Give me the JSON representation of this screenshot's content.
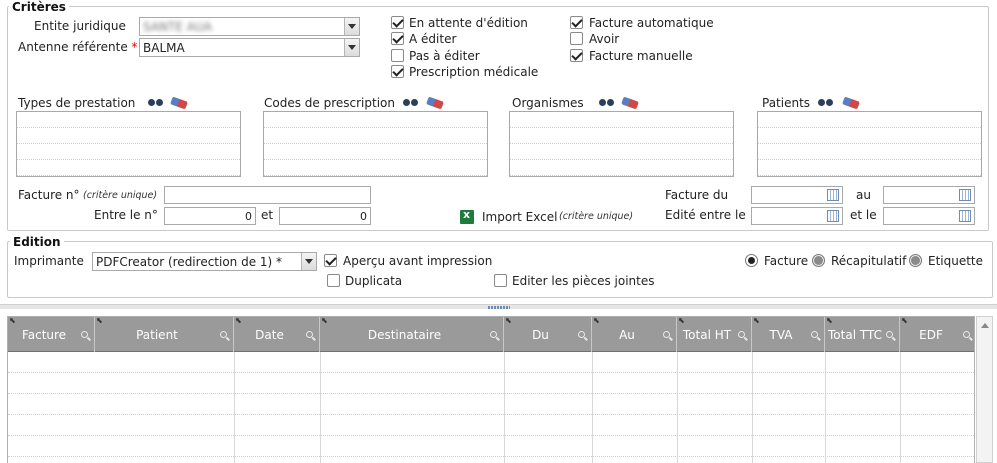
{
  "criteres": {
    "legend": "Critères",
    "entite_label": "Entite juridique",
    "entite_value": "SANTE AUA",
    "antenne_label": "Antenne référente",
    "required_mark": "*",
    "antenne_value": "BALMA",
    "checkboxes_col1": [
      {
        "label": "En attente d'édition",
        "checked": true
      },
      {
        "label": "A éditer",
        "checked": true
      },
      {
        "label": "Pas à éditer",
        "checked": false
      },
      {
        "label": "Prescription médicale",
        "checked": true
      }
    ],
    "checkboxes_col2": [
      {
        "label": "Facture automatique",
        "checked": true
      },
      {
        "label": "Avoir",
        "checked": false
      },
      {
        "label": "Facture manuelle",
        "checked": true
      }
    ],
    "lists": [
      {
        "label": "Types de prestation"
      },
      {
        "label": "Codes de prescription"
      },
      {
        "label": "Organismes"
      },
      {
        "label": "Patients"
      }
    ],
    "facture_no_label": "Facture n°",
    "critere_unique": "(critère unique)",
    "entre_label": "Entre le n°",
    "entre_from": "0",
    "et_label": "et",
    "entre_to": "0",
    "import_excel": "Import Excel",
    "facture_du_label": "Facture du",
    "au_label": "au",
    "edite_label": "Edité entre le",
    "et_le_label": "et le"
  },
  "edition": {
    "legend": "Edition",
    "imprimante_label": "Imprimante",
    "imprimante_value": "PDFCreator (redirection de 1) *",
    "apercu_label": "Aperçu avant impression",
    "apercu_checked": true,
    "duplicata_label": "Duplicata",
    "duplicata_checked": false,
    "pieces_label": "Editer les pièces jointes",
    "pieces_checked": false,
    "radios": [
      {
        "label": "Facture",
        "selected": true
      },
      {
        "label": "Récapitulatif",
        "selected": false
      },
      {
        "label": "Etiquette",
        "selected": false
      }
    ]
  },
  "grid": {
    "columns": [
      "Facture",
      "Patient",
      "Date",
      "Destinataire",
      "Du",
      "Au",
      "Total HT",
      "TVA",
      "Total TTC",
      "EDF"
    ]
  },
  "colors": {
    "header_bg": "#9a9a9a",
    "required": "#dd0000",
    "excel_green": "#1f7a3e"
  }
}
